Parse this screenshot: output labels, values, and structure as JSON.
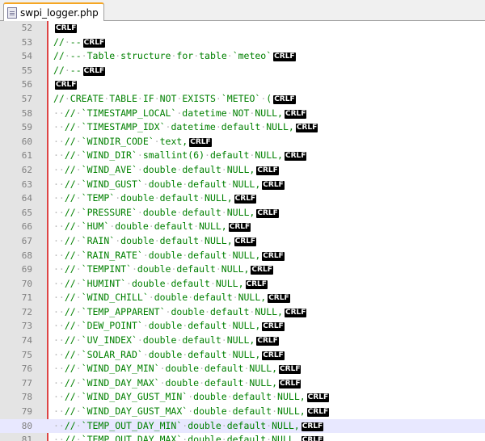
{
  "tab": {
    "title": "swpi_logger.php",
    "icon": "php-file-icon"
  },
  "eol_marker": "CRLF",
  "colors": {
    "comment": "#008000",
    "gutter": "#e4e4e4",
    "margin": "#dd4444",
    "current_line": "#e8e8ff"
  },
  "current_line": 80,
  "lines": [
    {
      "n": "52",
      "text": ""
    },
    {
      "n": "53",
      "text": "// --"
    },
    {
      "n": "54",
      "text": "// -- Table structure for table `meteo`"
    },
    {
      "n": "55",
      "text": "// --"
    },
    {
      "n": "56",
      "text": ""
    },
    {
      "n": "57",
      "text": "// CREATE TABLE IF NOT EXISTS `METEO` ("
    },
    {
      "n": "58",
      "text": "  // `TIMESTAMP_LOCAL` datetime NOT NULL,"
    },
    {
      "n": "59",
      "text": "  // `TIMESTAMP_IDX` datetime default NULL,"
    },
    {
      "n": "60",
      "text": "  // `WINDIR_CODE` text,"
    },
    {
      "n": "61",
      "text": "  // `WIND_DIR` smallint(6) default NULL,"
    },
    {
      "n": "62",
      "text": "  // `WIND_AVE` double default NULL,"
    },
    {
      "n": "63",
      "text": "  // `WIND_GUST` double default NULL,"
    },
    {
      "n": "64",
      "text": "  // `TEMP` double default NULL,"
    },
    {
      "n": "65",
      "text": "  // `PRESSURE` double default NULL,"
    },
    {
      "n": "66",
      "text": "  // `HUM` double default NULL,"
    },
    {
      "n": "67",
      "text": "  // `RAIN` double default NULL,"
    },
    {
      "n": "68",
      "text": "  // `RAIN_RATE` double default NULL,"
    },
    {
      "n": "69",
      "text": "  // `TEMPINT` double default NULL,"
    },
    {
      "n": "70",
      "text": "  // `HUMINT` double default NULL,"
    },
    {
      "n": "71",
      "text": "  // `WIND_CHILL` double default NULL,"
    },
    {
      "n": "72",
      "text": "  // `TEMP_APPARENT` double default NULL,"
    },
    {
      "n": "73",
      "text": "  // `DEW_POINT` double default NULL,"
    },
    {
      "n": "74",
      "text": "  // `UV_INDEX` double default NULL,"
    },
    {
      "n": "75",
      "text": "  // `SOLAR_RAD` double default NULL,"
    },
    {
      "n": "76",
      "text": "  // `WIND_DAY_MIN` double default NULL,"
    },
    {
      "n": "77",
      "text": "  // `WIND_DAY_MAX` double default NULL,"
    },
    {
      "n": "78",
      "text": "  // `WIND_DAY_GUST_MIN` double default NULL,"
    },
    {
      "n": "79",
      "text": "  // `WIND_DAY_GUST_MAX` double default NULL,"
    },
    {
      "n": "80",
      "text": "  // `TEMP_OUT_DAY_MIN` double default NULL,"
    },
    {
      "n": "81",
      "text": "  // `TEMP_OUT_DAY_MAX` double default NULL,"
    }
  ]
}
